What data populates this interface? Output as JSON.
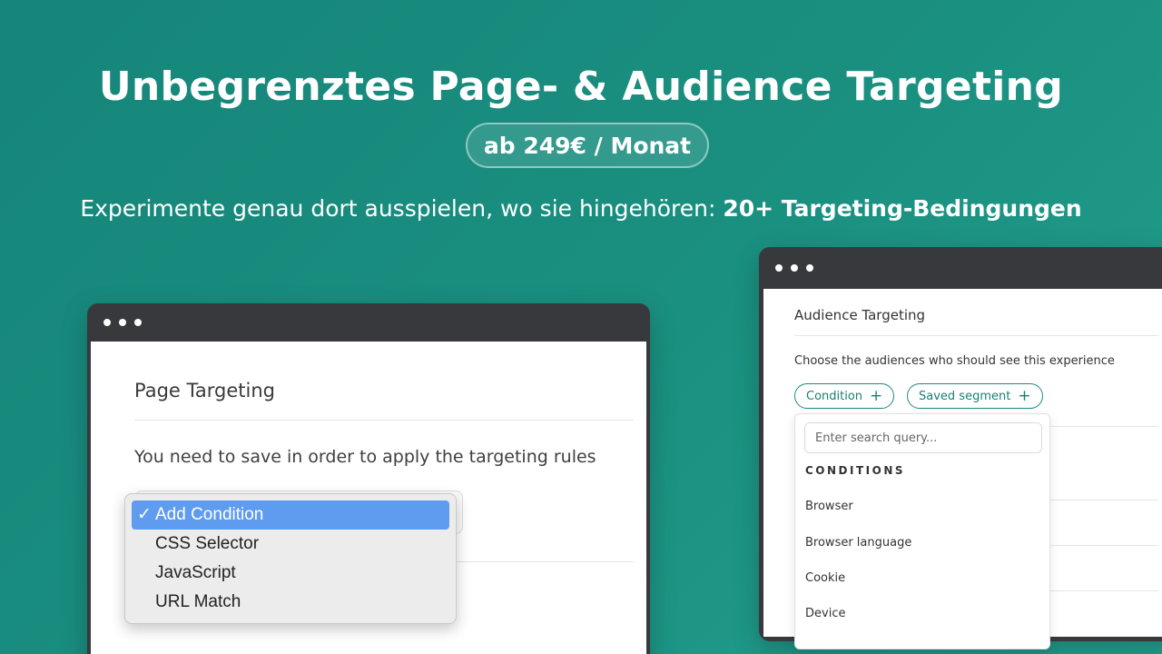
{
  "hero": {
    "headline": "Unbegrenztes Page- & Audience Targeting",
    "price": "ab 249€ / Monat",
    "subline_text": "Experimente genau dort ausspielen, wo sie hingehören: ",
    "subline_bold": "20+ Targeting-Bedingungen"
  },
  "colors": {
    "background": "#1a9080",
    "accent": "#1a8c7d",
    "selection": "#5f9cf0",
    "window_chrome": "#38393c"
  },
  "page_targeting": {
    "title": "Page Targeting",
    "message": "You need to save in order to apply the targeting rules",
    "menu": {
      "check_icon": "✓",
      "items": [
        {
          "label": "Add Condition",
          "selected": true
        },
        {
          "label": "CSS Selector",
          "selected": false
        },
        {
          "label": "JavaScript",
          "selected": false
        },
        {
          "label": "URL Match",
          "selected": false
        }
      ]
    }
  },
  "audience_targeting": {
    "title": "Audience Targeting",
    "description": "Choose the audiences who should see this experience",
    "chips": [
      {
        "label": "Condition",
        "icon": "plus-icon"
      },
      {
        "label": "Saved segment",
        "icon": "plus-icon"
      }
    ],
    "search_placeholder": "Enter search query...",
    "conditions_heading": "CONDITIONS",
    "conditions": [
      "Browser",
      "Browser language",
      "Cookie",
      "Device"
    ]
  }
}
